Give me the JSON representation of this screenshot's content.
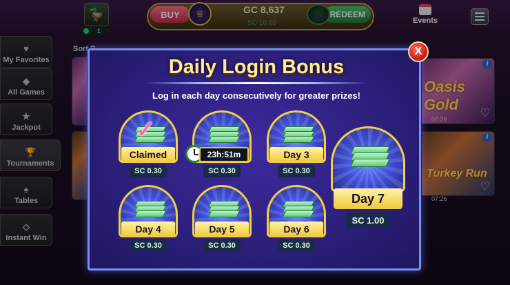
{
  "topbar": {
    "level": "1",
    "buy_label": "BUY",
    "gc_amount": "GC 8,637",
    "sc_amount": "SC 10.00",
    "redeem_label": "REDEEM",
    "events_label": "Events"
  },
  "sidebar": {
    "sort_label": "Sort B",
    "items": [
      {
        "label": "My Favorites",
        "icon": "heart-icon"
      },
      {
        "label": "All Games",
        "icon": "slot-icon"
      },
      {
        "label": "Jackpot",
        "icon": "jackpot-icon"
      },
      {
        "label": "Tournaments",
        "icon": "trophy-icon"
      },
      {
        "label": "Tables",
        "icon": "cards-icon"
      },
      {
        "label": "Instant Win",
        "icon": "diamond-icon"
      }
    ]
  },
  "tiles": [
    {
      "title": "Oasis Gold",
      "time": "07:26"
    },
    {
      "title": "Turkey Run",
      "time": "07:26"
    }
  ],
  "dialog": {
    "title": "Daily Login Bonus",
    "subtitle": "Log in each day consecutively for greater prizes!",
    "close_label": "X",
    "days": [
      {
        "label": "Claimed",
        "value": "SC 0.30",
        "state": "claimed"
      },
      {
        "label": "23h:51m",
        "value": "SC 0.30",
        "state": "timer"
      },
      {
        "label": "Day 3",
        "value": "SC 0.30",
        "state": "locked"
      },
      {
        "label": "Day 4",
        "value": "SC 0.30",
        "state": "locked"
      },
      {
        "label": "Day 5",
        "value": "SC 0.30",
        "state": "locked"
      },
      {
        "label": "Day 6",
        "value": "SC 0.30",
        "state": "locked"
      }
    ],
    "day7": {
      "label": "Day 7",
      "value": "SC 1.00"
    }
  },
  "colors": {
    "accent_gold": "#f2cf4a",
    "dialog_bg": "#2b1f7a",
    "dialog_border": "#7b8fe6",
    "sc_text": "#d9fbe3",
    "close_red": "#c01a1a"
  }
}
